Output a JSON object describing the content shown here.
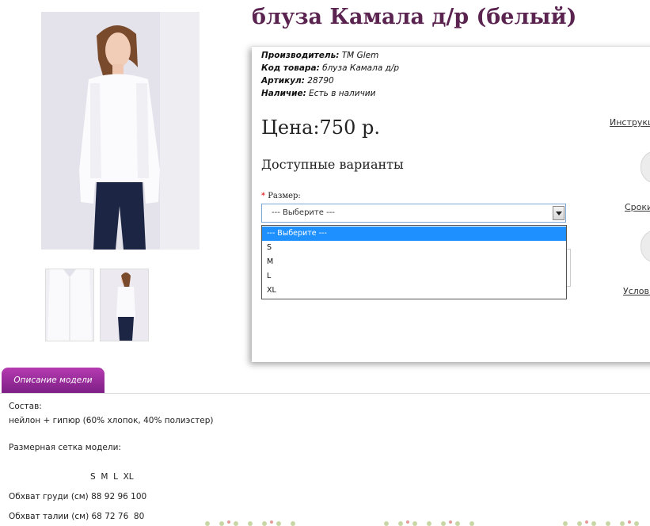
{
  "product": {
    "title": "блуза Камала д/р (белый)"
  },
  "meta": {
    "manufacturer_label": "Производитель:",
    "manufacturer_value": "TM Glem",
    "code_label": "Код товара:",
    "code_value": "блуза Камала д/р",
    "sku_label": "Артикул:",
    "sku_value": "28790",
    "availability_label": "Наличие:",
    "availability_value": "Есть в наличии"
  },
  "price": "Цена:750 р.",
  "variants_title": "Доступные варианты",
  "size": {
    "required_mark": "*",
    "label": "Размер:",
    "selected": "--- Выберите ---",
    "options": [
      "--- Выберите ---",
      "S",
      "M",
      "L",
      "XL"
    ]
  },
  "side_links": {
    "instructions": "Инструкц",
    "terms": "Сроки",
    "conditions": "Услови"
  },
  "tabs": {
    "description": "Описание модели"
  },
  "description": {
    "composition_label": "Состав:",
    "composition_value": "нейлон + гипюр (60% хлопок, 40% полиэстер)",
    "size_grid_label": "Размерная сетка модели:",
    "size_header": "S  M  L  XL",
    "chest": "Обхват груди (см) 88 92 96 100",
    "waist": "Обхват талии (см) 68 72 76  80"
  },
  "colors": {
    "title": "#5a2350",
    "tab": "#9b2b9e",
    "selection": "#1e90ff"
  }
}
